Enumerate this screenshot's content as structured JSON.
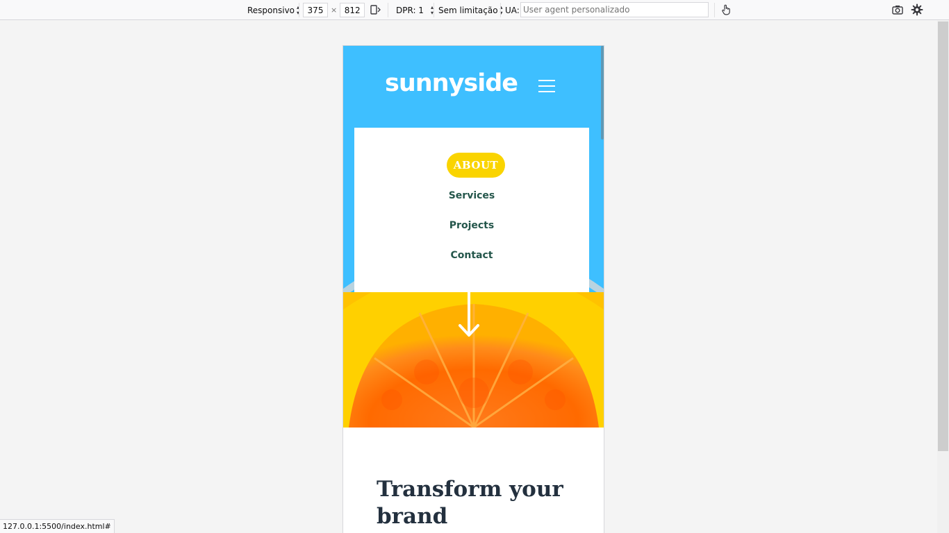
{
  "toolbar": {
    "device": "Responsivo",
    "width": "375",
    "times": "×",
    "height": "812",
    "dpr": "DPR: 1",
    "throttling": "Sem limitação",
    "ua_label": "UA:",
    "ua_placeholder": "User agent personalizado",
    "icons": [
      "rotate-icon",
      "touch-icon",
      "screenshot-icon",
      "settings-icon"
    ]
  },
  "site": {
    "logo": "sunnyside",
    "menu": {
      "about": "ABOUT",
      "items": [
        "Services",
        "Projects",
        "Contact"
      ]
    },
    "headline": "Transform your brand"
  },
  "status_url": "127.0.0.1:5500/index.html#",
  "colors": {
    "hero_blue": "#3ebfff",
    "about_yellow": "#fad400",
    "menu_text": "#24564b",
    "headline": "#23303e"
  }
}
